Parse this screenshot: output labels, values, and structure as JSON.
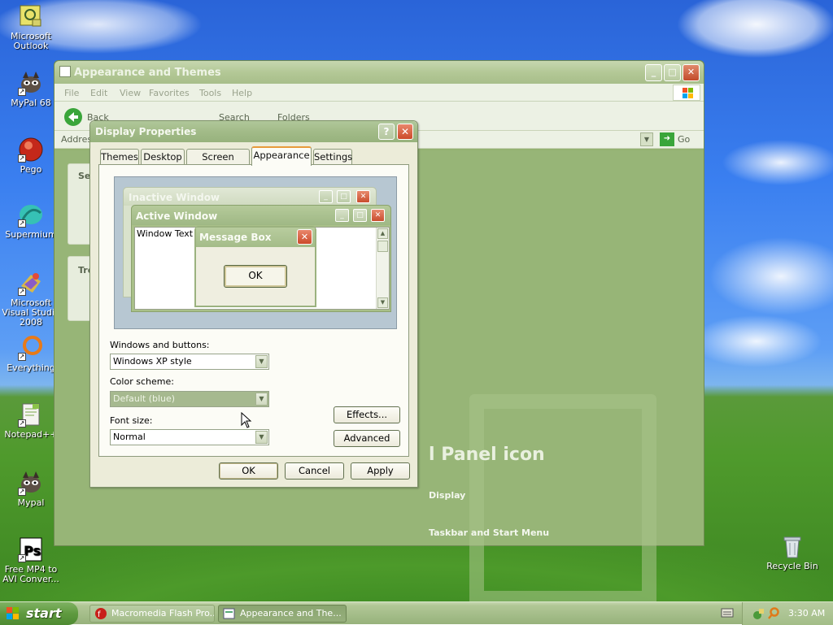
{
  "desktop": {
    "icons": [
      {
        "label": "Microsoft Outlook"
      },
      {
        "label": "MyPal 68"
      },
      {
        "label": "Pego"
      },
      {
        "label": "Supermium"
      },
      {
        "label": "Microsoft Visual Studio 2008"
      },
      {
        "label": "Everything"
      },
      {
        "label": "Notepad++"
      },
      {
        "label": "Mypal"
      },
      {
        "label": "Free MP4 to AVI Conver..."
      },
      {
        "label": "Recycle Bin"
      }
    ]
  },
  "explorer": {
    "title": "Appearance and Themes",
    "menu": [
      "File",
      "Edit",
      "View",
      "Favorites",
      "Tools",
      "Help"
    ],
    "toolbar": {
      "back": "Back",
      "search": "Search",
      "folders": "Folders"
    },
    "address_label": "Address",
    "go_label": "Go",
    "side_panels": [
      {
        "title": "Se"
      },
      {
        "title": "Tro"
      }
    ],
    "heading": "l Panel icon",
    "links": [
      "Display",
      "Taskbar and Start Menu"
    ]
  },
  "dialog": {
    "title": "Display Properties",
    "help_glyph": "?",
    "close_glyph": "✕",
    "tabs": [
      "Themes",
      "Desktop",
      "Screen Saver",
      "Appearance",
      "Settings"
    ],
    "active_tab": "Appearance",
    "preview": {
      "inactive_title": "Inactive Window",
      "active_title": "Active Window",
      "window_text": "Window Text",
      "message_box_title": "Message Box",
      "message_box_ok": "OK"
    },
    "windows_buttons": {
      "label": "Windows and buttons:",
      "value": "Windows XP style"
    },
    "color_scheme": {
      "label": "Color scheme:",
      "value": "Default (blue)"
    },
    "font_size": {
      "label": "Font size:",
      "value": "Normal"
    },
    "effects_button": "Effects...",
    "advanced_button": "Advanced",
    "ok_button": "OK",
    "cancel_button": "Cancel",
    "apply_button": "Apply"
  },
  "taskbar": {
    "start_label": "start",
    "tasks": [
      {
        "label": "Macromedia Flash Pro...",
        "active": false
      },
      {
        "label": "Appearance and The...",
        "active": true
      }
    ],
    "clock": "3:30 AM"
  },
  "colors": {
    "taskbar": "#a3bc88",
    "dialog_face": "#ececd9",
    "close_red": "#cc4a2a"
  }
}
